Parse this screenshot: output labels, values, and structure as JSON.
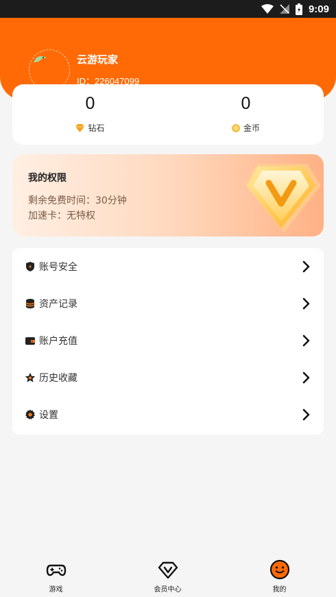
{
  "status_bar": {
    "time": "9:09"
  },
  "user": {
    "name": "云游玩家",
    "id_text": "ID：226047099"
  },
  "stats": [
    {
      "value": "0",
      "label": "钻石",
      "icon": "diamond-icon"
    },
    {
      "value": "0",
      "label": "金币",
      "icon": "coin-icon"
    }
  ],
  "rights": {
    "title": "我的权限",
    "free_time": "剩余免费时间：30分钟",
    "accel_card": "加速卡：无特权"
  },
  "menu": [
    {
      "label": "账号安全",
      "icon": "shield-icon"
    },
    {
      "label": "资产记录",
      "icon": "database-icon"
    },
    {
      "label": "账户充值",
      "icon": "wallet-icon"
    },
    {
      "label": "历史收藏",
      "icon": "star-icon"
    },
    {
      "label": "设置",
      "icon": "gear-icon"
    }
  ],
  "tabs": [
    {
      "label": "游戏",
      "icon": "gamepad-icon"
    },
    {
      "label": "会员中心",
      "icon": "vip-diamond-icon"
    },
    {
      "label": "我的",
      "icon": "smiley-icon",
      "active": true
    }
  ],
  "colors": {
    "accent": "#ff6a06",
    "background": "#f5f5f5",
    "card": "#ffffff"
  }
}
